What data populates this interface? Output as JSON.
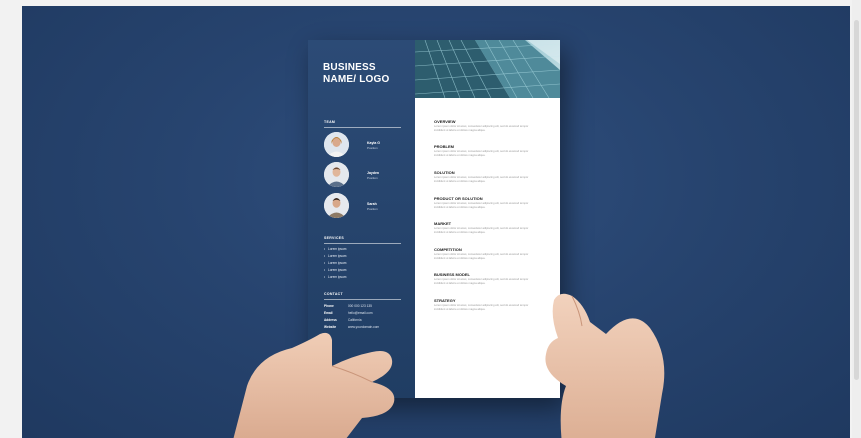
{
  "colors": {
    "background": "#27446f",
    "panel": "#24426b",
    "paper": "#ffffff",
    "skin": "#e8c3aa"
  },
  "flyer": {
    "logo_line1": "BUSINESS",
    "logo_line2": "NAME/ LOGO",
    "team": {
      "heading": "TEAM",
      "members": [
        {
          "name": "Kayla G",
          "position": "Position"
        },
        {
          "name": "Jayden",
          "position": "Position"
        },
        {
          "name": "Sarah",
          "position": "Position"
        }
      ]
    },
    "services": {
      "heading": "SERVICES",
      "items": [
        "Lorem ipsum",
        "Lorem ipsum",
        "Lorem ipsum",
        "Lorem ipsum",
        "Lorem ipsum"
      ]
    },
    "contact": {
      "heading": "CONTACT",
      "rows": [
        {
          "label": "Phone",
          "value": "000 000 123 135"
        },
        {
          "label": "Email",
          "value": "hello@email.com"
        },
        {
          "label": "Address",
          "value": "California"
        },
        {
          "label": "Website",
          "value": "www.yourdomain.com"
        }
      ]
    },
    "sections": [
      {
        "title": "OVERVIEW",
        "body": "Lorem ipsum dolor sit amet, consectetur adipiscing elit, sed do eiusmod tempor incididunt ut labore et dolore magna aliqua."
      },
      {
        "title": "PROBLEM",
        "body": "Lorem ipsum dolor sit amet, consectetur adipiscing elit, sed do eiusmod tempor incididunt ut labore et dolore magna aliqua."
      },
      {
        "title": "SOLUTION",
        "body": "Lorem ipsum dolor sit amet, consectetur adipiscing elit, sed do eiusmod tempor incididunt ut labore et dolore magna aliqua."
      },
      {
        "title": "PRODUCT OR SOLUTION",
        "body": "Lorem ipsum dolor sit amet, consectetur adipiscing elit, sed do eiusmod tempor incididunt ut labore et dolore magna aliqua."
      },
      {
        "title": "MARKET",
        "body": "Lorem ipsum dolor sit amet, consectetur adipiscing elit, sed do eiusmod tempor incididunt ut labore et dolore magna aliqua."
      },
      {
        "title": "COMPETITION",
        "body": "Lorem ipsum dolor sit amet, consectetur adipiscing elit, sed do eiusmod tempor incididunt ut labore et dolore magna aliqua."
      },
      {
        "title": "BUSINESS MODEL",
        "body": "Lorem ipsum dolor sit amet, consectetur adipiscing elit, sed do eiusmod tempor incididunt ut labore et dolore magna aliqua."
      },
      {
        "title": "STRATEGY",
        "body": "Lorem ipsum dolor sit amet, consectetur adipiscing elit, sed do eiusmod tempor incididunt ut labore et dolore magna aliqua."
      }
    ]
  }
}
